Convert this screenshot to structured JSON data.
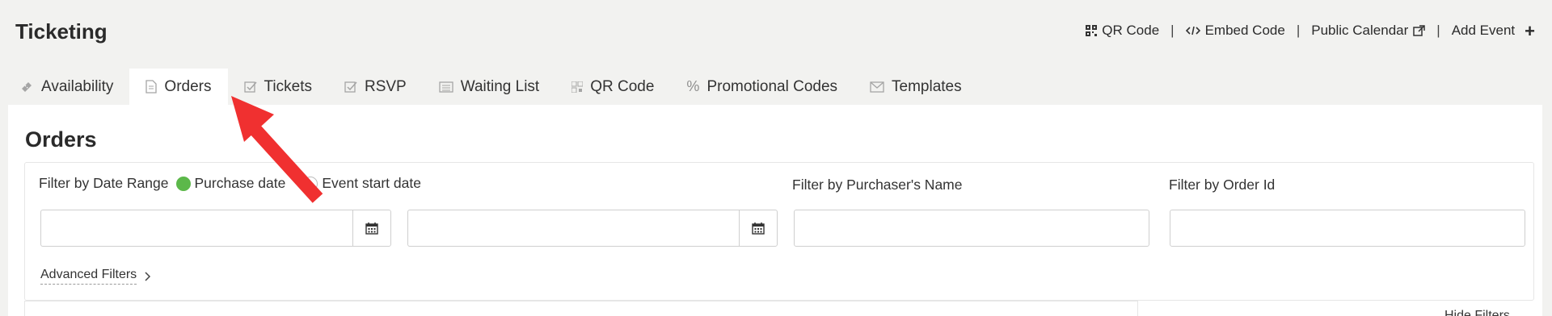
{
  "header": {
    "title": "Ticketing",
    "links": {
      "qr_code": "QR Code",
      "embed_code": "Embed Code",
      "public_calendar": "Public Calendar",
      "add_event": "Add Event",
      "separator": "|"
    }
  },
  "tabs": [
    {
      "label": "Availability",
      "icon": "ticket-icon"
    },
    {
      "label": "Orders",
      "icon": "document-icon",
      "active": true
    },
    {
      "label": "Tickets",
      "icon": "checkbox-icon"
    },
    {
      "label": "RSVP",
      "icon": "checkbox-icon"
    },
    {
      "label": "Waiting List",
      "icon": "list-icon"
    },
    {
      "label": "QR Code",
      "icon": "qr-icon"
    },
    {
      "label": "Promotional Codes",
      "icon": "percent-icon"
    },
    {
      "label": "Templates",
      "icon": "envelope-icon"
    }
  ],
  "orders": {
    "title": "Orders",
    "filters": {
      "date_range_label": "Filter by Date Range",
      "purchase_date": "Purchase date",
      "event_start_date": "Event start date",
      "purchaser_label": "Filter by Purchaser's Name",
      "order_id_label": "Filter by Order Id",
      "advanced_filters": "Advanced Filters",
      "hide_filters": "Hide Filters",
      "start_date_value": "",
      "end_date_value": "",
      "purchaser_value": "",
      "order_id_value": ""
    }
  },
  "colors": {
    "radio_selected": "#5cb84a",
    "annotation_arrow": "#f03030"
  }
}
